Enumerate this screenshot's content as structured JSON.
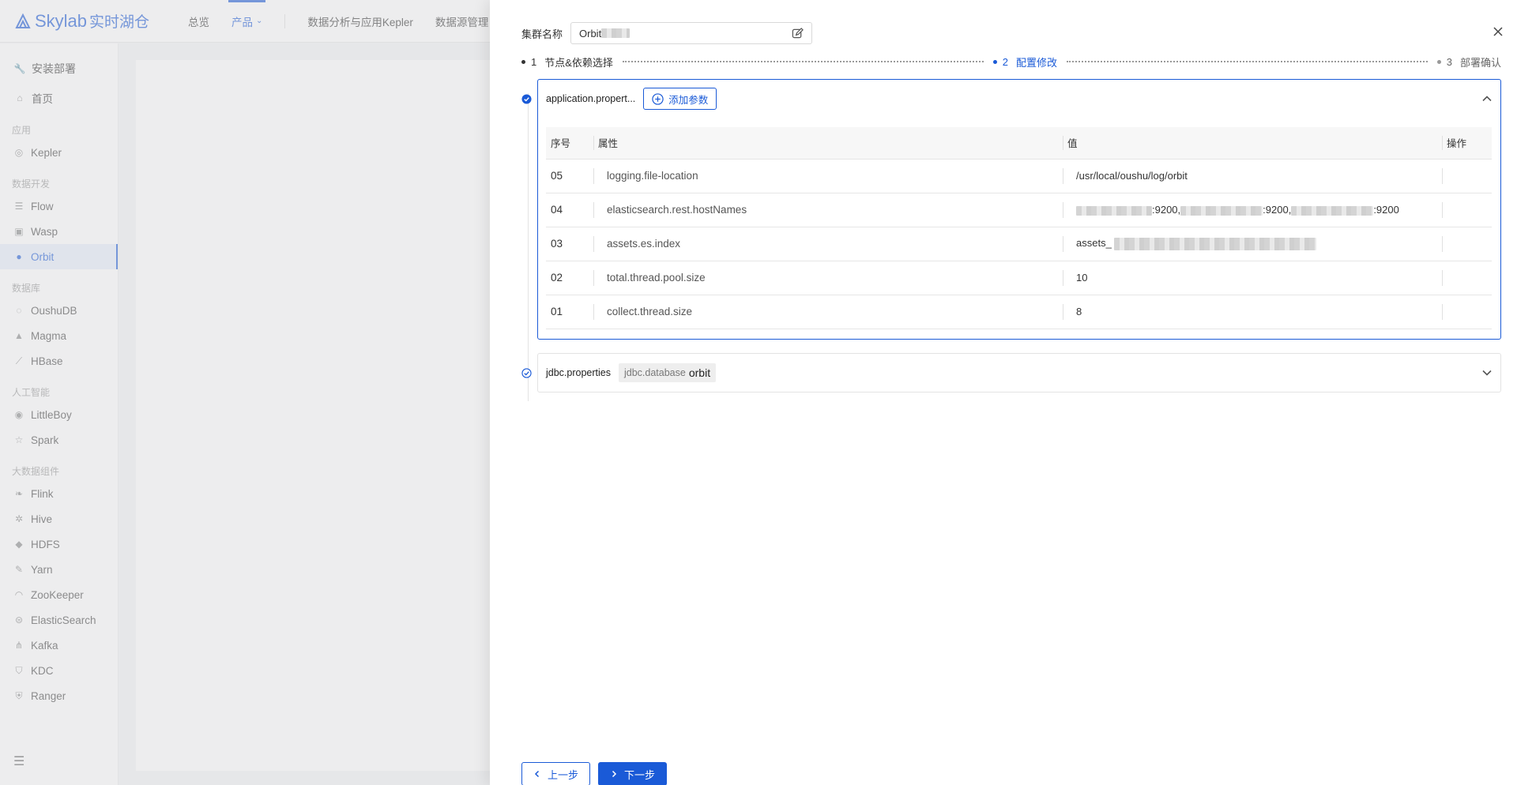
{
  "app": {
    "logo_text": "Skylab",
    "logo_cn": "实时湖仓",
    "topnav": [
      {
        "label": "总览"
      },
      {
        "label": "产品"
      },
      {
        "label": "数据分析与应用Kepler"
      },
      {
        "label": "数据源管理"
      }
    ],
    "sidebar": {
      "install": "安装部署",
      "home": "首页",
      "groups": [
        {
          "title": "应用",
          "items": [
            "Kepler"
          ]
        },
        {
          "title": "数据开发",
          "items": [
            "Flow",
            "Wasp",
            "Orbit"
          ]
        },
        {
          "title": "数据库",
          "items": [
            "OushuDB",
            "Magma",
            "HBase"
          ]
        },
        {
          "title": "人工智能",
          "items": [
            "LittleBoy",
            "Spark"
          ]
        },
        {
          "title": "大数据组件",
          "items": [
            "Flink",
            "Hive",
            "HDFS",
            "Yarn",
            "ZooKeeper",
            "ElasticSearch",
            "Kafka",
            "KDC",
            "Ranger"
          ]
        }
      ],
      "active_item": "Orbit"
    }
  },
  "drawer": {
    "cluster_name_label": "集群名称",
    "cluster_name_value": "Orbit",
    "steps": [
      {
        "num": "1",
        "label": "节点&依赖选择",
        "state": "done"
      },
      {
        "num": "2",
        "label": "配置修改",
        "state": "active"
      },
      {
        "num": "3",
        "label": "部署确认",
        "state": "pending"
      }
    ],
    "panels": {
      "application": {
        "title": "application.propert...",
        "add_param_label": "添加参数",
        "columns": {
          "seq": "序号",
          "prop": "属性",
          "value": "值",
          "action": "操作"
        },
        "rows": [
          {
            "seq": "05",
            "prop": "logging.file-location",
            "value": "/usr/local/oushu/log/orbit"
          },
          {
            "seq": "04",
            "prop": "elasticsearch.rest.hostNames",
            "value_parts": [
              ":9200,",
              ":9200,",
              ":9200"
            ]
          },
          {
            "seq": "03",
            "prop": "assets.es.index",
            "value": "assets_"
          },
          {
            "seq": "02",
            "prop": "total.thread.pool.size",
            "value": "10"
          },
          {
            "seq": "01",
            "prop": "collect.thread.size",
            "value": "8"
          }
        ]
      },
      "jdbc": {
        "title": "jdbc.properties",
        "tag_key": "jdbc.database",
        "tag_value": "orbit"
      }
    },
    "footer": {
      "prev_label": "上一步",
      "next_label": "下一步"
    }
  },
  "colors": {
    "primary": "#1a5ad7"
  }
}
